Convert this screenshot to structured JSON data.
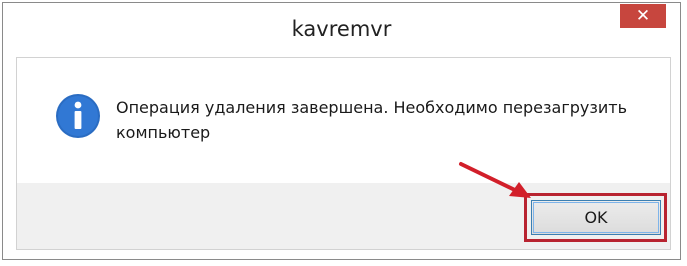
{
  "window": {
    "title": "kavremvr",
    "close_glyph": "✕"
  },
  "dialog": {
    "icon": "info-icon",
    "message": "Операция удаления завершена. Необходимо перезагрузить компьютер",
    "ok_label": "OK"
  },
  "colors": {
    "close_button": "#c7463e",
    "info_icon": "#2a6cc2",
    "annotation_red": "#b82330",
    "button_focus_border": "#3c7fb1"
  }
}
